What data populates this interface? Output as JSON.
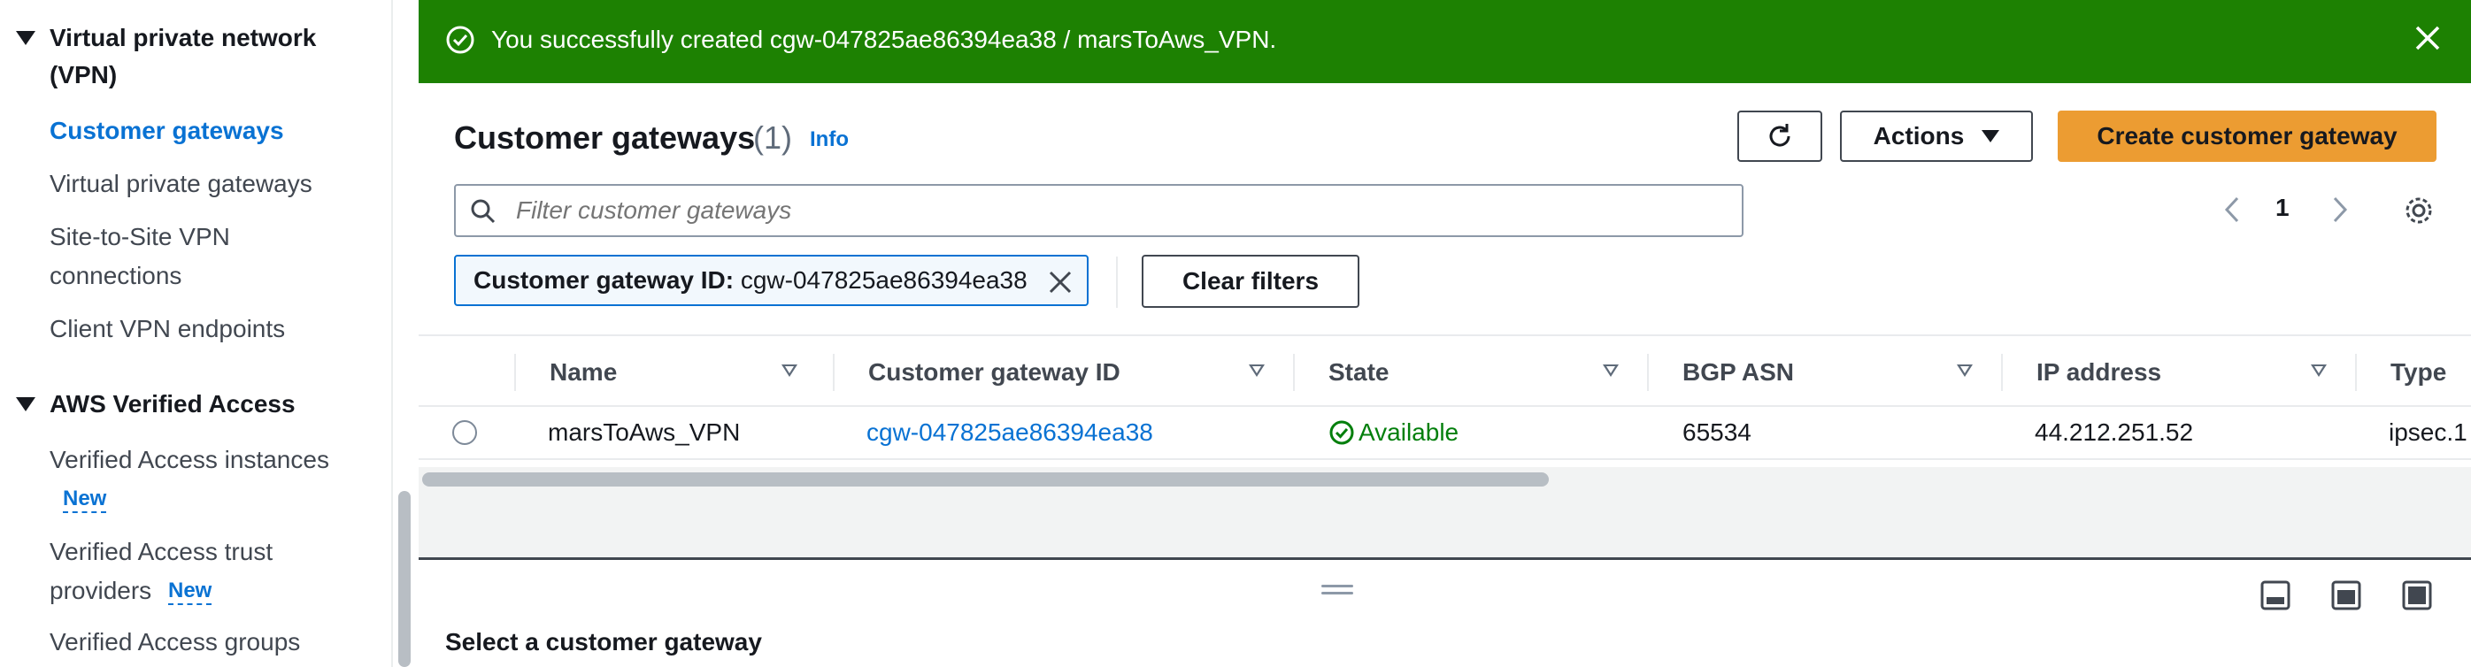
{
  "sidebar": {
    "vpn_section": "Virtual private network (VPN)",
    "vpn_items": [
      {
        "label": "Customer gateways",
        "active": true
      },
      {
        "label": "Virtual private gateways"
      },
      {
        "label": "Site-to-Site VPN connections"
      },
      {
        "label": "Client VPN endpoints"
      }
    ],
    "ava_section": "AWS Verified Access",
    "ava_items": [
      {
        "label": "Verified Access instances",
        "badge": "New"
      },
      {
        "label": "Verified Access trust providers",
        "badge": "New"
      },
      {
        "label": "Verified Access groups"
      }
    ]
  },
  "flash": {
    "message": "You successfully created cgw-047825ae86394ea38 / marsToAws_VPN.",
    "type": "success",
    "color": "#1d8102"
  },
  "header": {
    "title": "Customer gateways",
    "count": "(1)",
    "info": "Info"
  },
  "toolbar": {
    "refresh_icon": "refresh-icon",
    "actions_label": "Actions",
    "create_label": "Create customer gateway"
  },
  "search": {
    "placeholder": "Filter customer gateways",
    "value": ""
  },
  "pagination": {
    "current_page": "1"
  },
  "filter_token": {
    "key": "Customer gateway ID:",
    "value": "cgw-047825ae86394ea38"
  },
  "clear_filters_label": "Clear filters",
  "table": {
    "columns": [
      "Name",
      "Customer gateway ID",
      "State",
      "BGP ASN",
      "IP address",
      "Type"
    ],
    "rows": [
      {
        "name": "marsToAws_VPN",
        "id": "cgw-047825ae86394ea38",
        "state": "Available",
        "bgp_asn": "65534",
        "ip": "44.212.251.52",
        "type": "ipsec.1"
      }
    ]
  },
  "split_panel": {
    "title": "Select a customer gateway"
  },
  "colors": {
    "accent": "#0972d3",
    "primary_button": "#ec9c32",
    "success": "#037f0c"
  }
}
